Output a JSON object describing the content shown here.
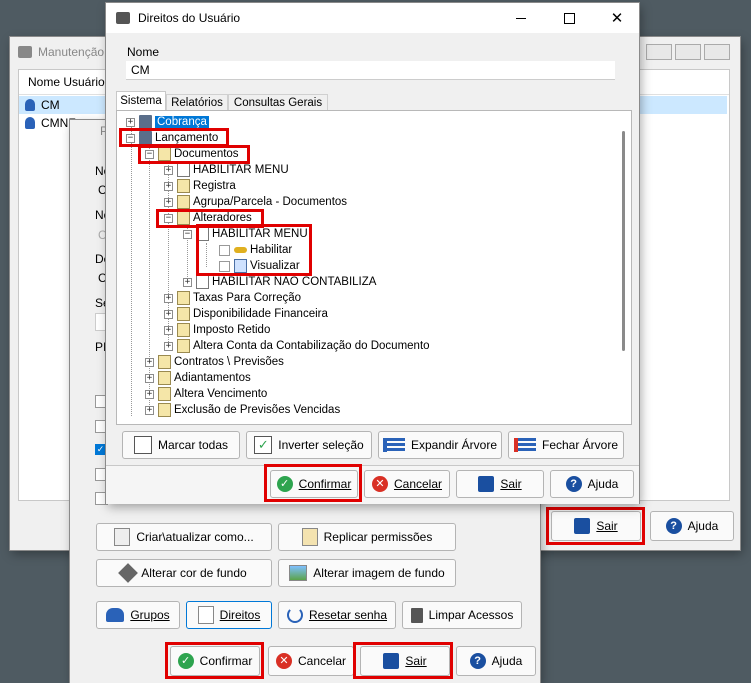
{
  "bg_window": {
    "title": "Manutenção",
    "column_header": "Nome Usuário",
    "users": [
      "CM",
      "CMNF"
    ],
    "sair": "Sair",
    "ajuda": "Ajuda"
  },
  "mid_window": {
    "title_fragment": "P",
    "field_fragments": [
      "No",
      "Cl",
      "No",
      "Cl",
      "De",
      "Cl",
      "Se",
      "PI"
    ],
    "buttons": {
      "criar": "Criar\\atualizar como...",
      "replicar": "Replicar permissões",
      "alterar_cor": "Alterar cor de fundo",
      "alterar_imagem": "Alterar imagem de fundo",
      "grupos": "Grupos",
      "direitos": "Direitos",
      "resetar": "Resetar senha",
      "limpar": "Limpar Acessos",
      "confirmar": "Confirmar",
      "cancelar": "Cancelar",
      "sair": "Sair",
      "ajuda": "Ajuda"
    }
  },
  "dialog": {
    "title": "Direitos do Usuário",
    "name_label": "Nome",
    "name_value": "CM",
    "tabs": [
      "Sistema",
      "Relatórios",
      "Consultas Gerais"
    ],
    "tree": {
      "cobranca": "Cobrança",
      "lancamento": "Lançamento",
      "documentos": "Documentos",
      "habilitar_menu": "HABILITAR MENU",
      "registra": "Registra",
      "agrupa": "Agrupa/Parcela - Documentos",
      "alteradores": "Alteradores",
      "habilitar_menu2": "HABILITAR MENU",
      "habilitar": "Habilitar",
      "visualizar": "Visualizar",
      "habilitar_nao_contab": "HABILITAR NÃO CONTABILIZA",
      "taxas": "Taxas Para Correção",
      "disponibilidade": "Disponibilidade Financeira",
      "imposto": "Imposto Retido",
      "altera_conta": "Altera Conta da Contabilização do Documento",
      "contratos": "Contratos \\ Previsões",
      "adiantamentos": "Adiantamentos",
      "altera_venc": "Altera Vencimento",
      "exclusao": "Exclusão de Previsões Vencidas"
    },
    "buttons": {
      "marcar": "Marcar todas",
      "inverter": "Inverter seleção",
      "expandir": "Expandir Árvore",
      "fechar": "Fechar Árvore",
      "confirmar": "Confirmar",
      "cancelar": "Cancelar",
      "sair": "Sair",
      "ajuda": "Ajuda"
    }
  },
  "colors": {
    "highlight": "#e00000",
    "confirm": "#2ea44f",
    "cancel": "#d93025",
    "help": "#1a4fa0",
    "selection": "#0078d7"
  }
}
